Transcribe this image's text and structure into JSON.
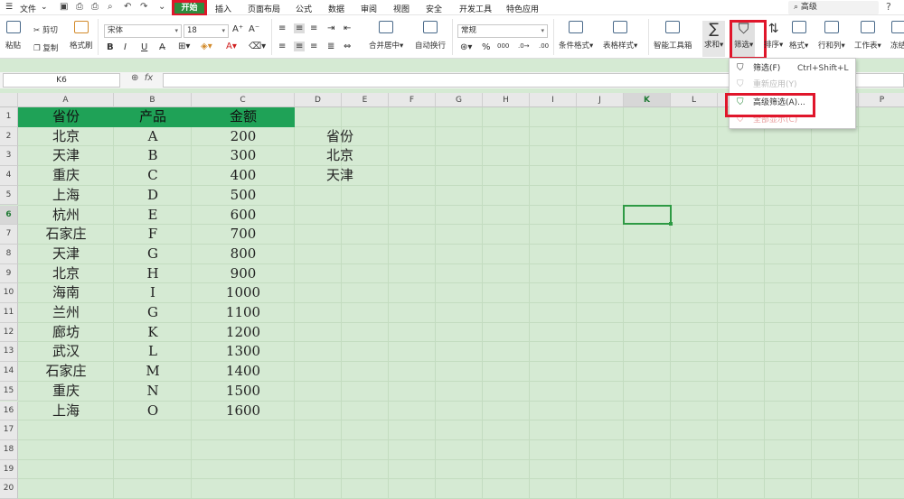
{
  "menu": {
    "file": "文件",
    "tabs": [
      "开始",
      "插入",
      "页面布局",
      "公式",
      "数据",
      "审阅",
      "视图",
      "安全",
      "开发工具",
      "特色应用"
    ],
    "search": "高级",
    "help": "?"
  },
  "ribbon": {
    "paste": "粘贴",
    "cut": "剪切",
    "copy": "复制",
    "format_painter": "格式刷",
    "font_name": "宋体",
    "font_size": "18",
    "bold": "B",
    "italic": "I",
    "underline": "U",
    "merge": "合并居中",
    "wrap": "自动换行",
    "number_format": "常规",
    "percent": "%",
    "cond_format": "条件格式",
    "table_style": "表格样式",
    "smart_tools": "智能工具箱",
    "sum": "求和",
    "filter": "筛选",
    "sort": "排序",
    "format": "格式",
    "row_col": "行和列",
    "worksheet": "工作表",
    "freeze": "冻结"
  },
  "formula_bar": {
    "cell_ref": "K6",
    "fx": "fx",
    "value": ""
  },
  "columns": [
    "A",
    "B",
    "C",
    "D",
    "E",
    "F",
    "G",
    "H",
    "I",
    "J",
    "K",
    "L",
    "M",
    "N",
    "O",
    "P"
  ],
  "rows": [
    "1",
    "2",
    "3",
    "4",
    "5",
    "6",
    "7",
    "8",
    "9",
    "10",
    "11",
    "12",
    "13",
    "14",
    "15",
    "16",
    "17",
    "18",
    "19",
    "20"
  ],
  "table": {
    "headers": [
      "省份",
      "产品",
      "金额"
    ],
    "data": [
      [
        "北京",
        "A",
        "200"
      ],
      [
        "天津",
        "B",
        "300"
      ],
      [
        "重庆",
        "C",
        "400"
      ],
      [
        "上海",
        "D",
        "500"
      ],
      [
        "杭州",
        "E",
        "600"
      ],
      [
        "石家庄",
        "F",
        "700"
      ],
      [
        "天津",
        "G",
        "800"
      ],
      [
        "北京",
        "H",
        "900"
      ],
      [
        "海南",
        "I",
        "1000"
      ],
      [
        "兰州",
        "G",
        "1100"
      ],
      [
        "廊坊",
        "K",
        "1200"
      ],
      [
        "武汉",
        "L",
        "1300"
      ],
      [
        "石家庄",
        "M",
        "1400"
      ],
      [
        "重庆",
        "N",
        "1500"
      ],
      [
        "上海",
        "O",
        "1600"
      ]
    ]
  },
  "criteria": [
    "省份",
    "北京",
    "天津"
  ],
  "dropdown": {
    "filter": "筛选(F)",
    "filter_shortcut": "Ctrl+Shift+L",
    "reapply": "重新应用(Y)",
    "advanced": "高级筛选(A)...",
    "show_all": "全部显示(C)"
  },
  "colors": {
    "header_fill": "#1fa257",
    "sheet_bg": "#d5ead3",
    "highlight": "#e0162b",
    "accent": "#2e8b3e"
  }
}
